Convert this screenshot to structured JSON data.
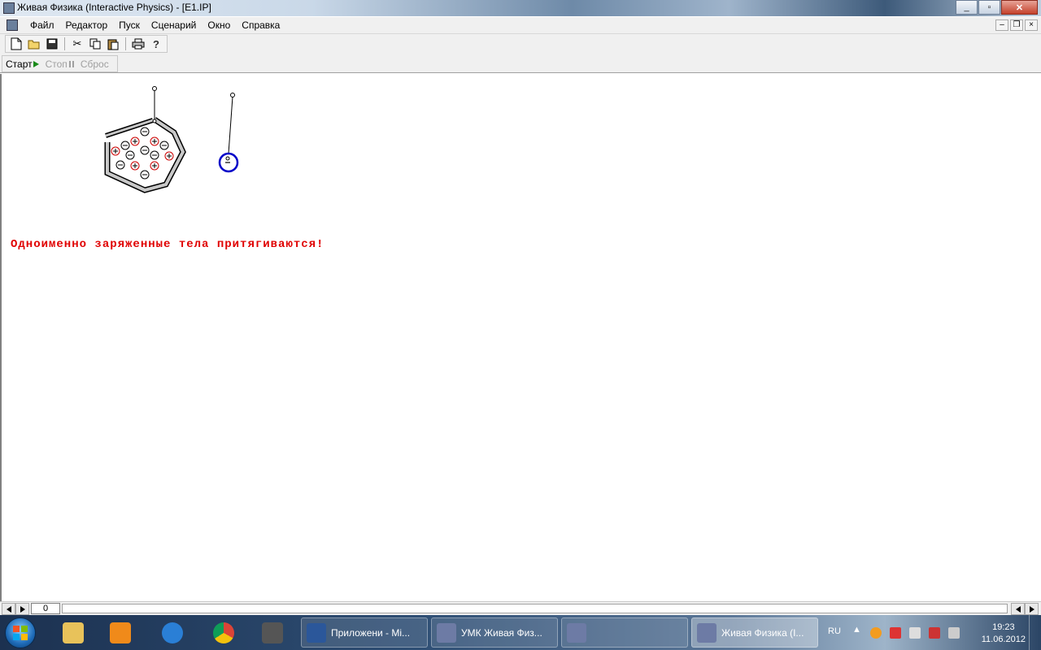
{
  "window": {
    "title": "Живая Физика (Interactive Physics) - [E1.IP]",
    "minimize": "_",
    "maximize": "▫",
    "close": "✕"
  },
  "menu": {
    "items": [
      "Файл",
      "Редактор",
      "Пуск",
      "Сценарий",
      "Окно",
      "Справка"
    ]
  },
  "toolbar": {
    "icons": [
      "new-file-icon",
      "open-folder-icon",
      "save-disk-icon",
      "cut-scissors-icon",
      "copy-icon",
      "paste-icon",
      "print-icon",
      "help-question-icon"
    ]
  },
  "run_controls": {
    "start": "Старт",
    "stop": "Стоп",
    "reset": "Сброс"
  },
  "canvas": {
    "message": "Одноименно заряженные тела притягиваются!",
    "message_color": "#e00000",
    "plus_sign": "+",
    "minus_sign": "−"
  },
  "scrollbar": {
    "frame_counter": "0"
  },
  "taskbar": {
    "pinned": [
      "explorer-icon",
      "media-player-icon",
      "internet-explorer-icon",
      "chrome-icon",
      "app-icon"
    ],
    "tasks": [
      {
        "label": "Приложени - Mi..."
      },
      {
        "label": "УМК Живая Физ..."
      },
      {
        "label": ""
      },
      {
        "label": "Живая Физика (I..."
      }
    ],
    "language": "RU",
    "time": "19:23",
    "date": "11.06.2012"
  }
}
